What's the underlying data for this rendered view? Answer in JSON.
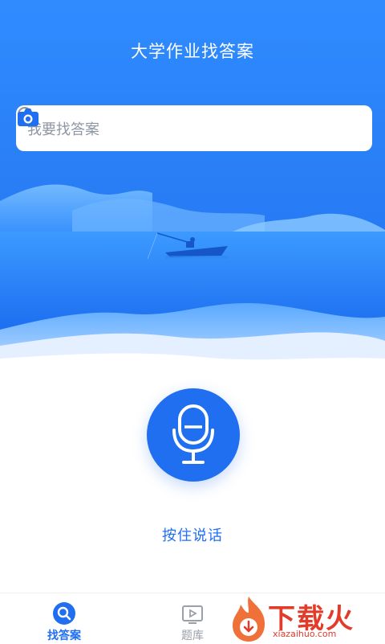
{
  "header": {
    "title": "大学作业找答案"
  },
  "search": {
    "placeholder": "我要找答案",
    "icon": "search-icon",
    "camera_icon": "camera-icon"
  },
  "voice": {
    "icon": "microphone-icon",
    "label": "按住说话"
  },
  "tabs": [
    {
      "label": "找答案",
      "icon": "search-icon",
      "active": true
    },
    {
      "label": "题库",
      "icon": "play-board-icon",
      "active": false
    }
  ],
  "watermark": {
    "brand": "下载火",
    "site": "xiazaihuo.com"
  },
  "colors": {
    "primary": "#1f6ff0",
    "hero_top": "#2f8cff",
    "placeholder": "#8f96a3",
    "inactive_tab": "#9aa0a8",
    "watermark": "#e23b2a"
  }
}
